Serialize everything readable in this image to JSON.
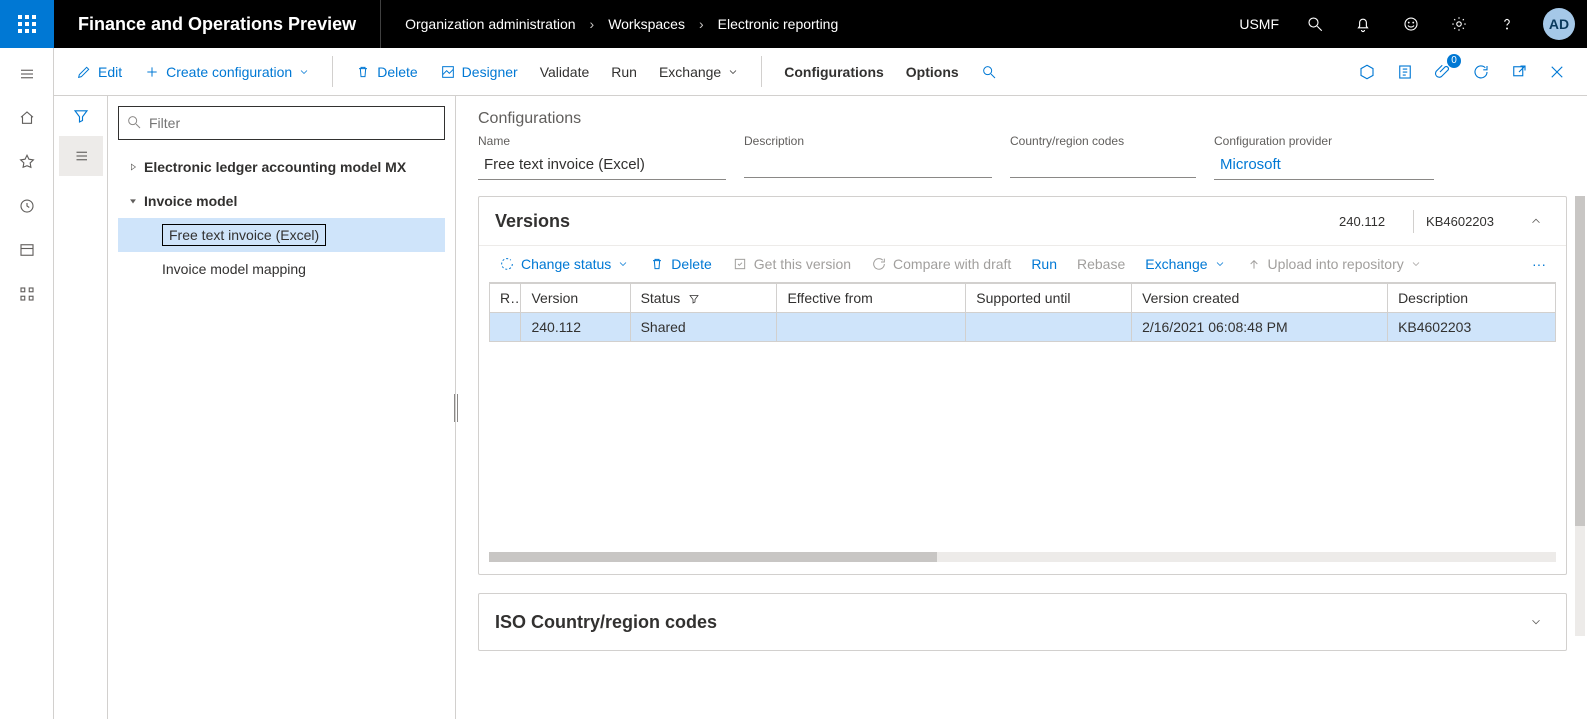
{
  "app_title": "Finance and Operations Preview",
  "breadcrumb": [
    "Organization administration",
    "Workspaces",
    "Electronic reporting"
  ],
  "company": "USMF",
  "avatar": "AD",
  "actionbar": {
    "edit": "Edit",
    "create": "Create configuration",
    "delete": "Delete",
    "designer": "Designer",
    "validate": "Validate",
    "run": "Run",
    "exchange": "Exchange",
    "configurations": "Configurations",
    "options": "Options",
    "attachments_badge": "0"
  },
  "tree": {
    "filter_placeholder": "Filter",
    "items": [
      {
        "label": "Electronic ledger accounting model MX",
        "level": 0,
        "expanded": false,
        "selected": false
      },
      {
        "label": "Invoice model",
        "level": 0,
        "expanded": true,
        "selected": false
      },
      {
        "label": "Free text invoice (Excel)",
        "level": 2,
        "expanded": false,
        "selected": true
      },
      {
        "label": "Invoice model mapping",
        "level": 2,
        "expanded": false,
        "selected": false
      }
    ]
  },
  "details": {
    "section_title": "Configurations",
    "labels": {
      "name": "Name",
      "description": "Description",
      "country": "Country/region codes",
      "provider": "Configuration provider"
    },
    "values": {
      "name": "Free text invoice (Excel)",
      "description": "",
      "country": "",
      "provider": "Microsoft"
    }
  },
  "versions": {
    "title": "Versions",
    "summary_version": "240.112",
    "summary_kb": "KB4602203",
    "toolbar": {
      "change_status": "Change status",
      "delete": "Delete",
      "get_version": "Get this version",
      "compare": "Compare with draft",
      "run": "Run",
      "rebase": "Rebase",
      "exchange": "Exchange",
      "upload": "Upload into repository"
    },
    "columns": {
      "r": "R...",
      "version": "Version",
      "status": "Status",
      "effective": "Effective from",
      "supported": "Supported until",
      "created": "Version created",
      "description": "Description"
    },
    "rows": [
      {
        "version": "240.112",
        "status": "Shared",
        "effective": "",
        "supported": "",
        "created": "2/16/2021 06:08:48 PM",
        "description": "KB4602203"
      }
    ]
  },
  "iso": {
    "title": "ISO Country/region codes"
  }
}
